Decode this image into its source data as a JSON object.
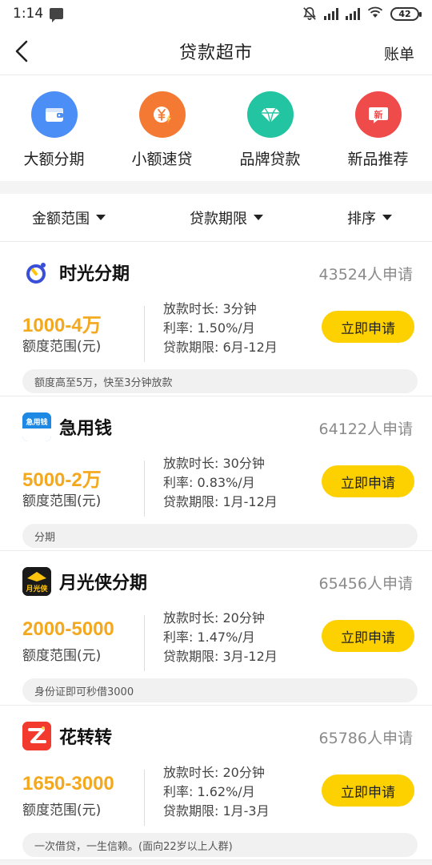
{
  "status_bar": {
    "time": "1:14",
    "battery": "42"
  },
  "nav": {
    "title": "贷款超市",
    "right_label": "账单"
  },
  "categories": [
    {
      "label": "大额分期",
      "icon": "wallet-icon",
      "color": "#4b8ef5"
    },
    {
      "label": "小额速贷",
      "icon": "yen-lightning-icon",
      "color": "#f47a34"
    },
    {
      "label": "品牌贷款",
      "icon": "diamond-icon",
      "color": "#22c4a1"
    },
    {
      "label": "新品推荐",
      "icon": "new-badge-icon",
      "color": "#f04b4b",
      "badge_text": "新"
    }
  ],
  "filters": [
    {
      "label": "金额范围"
    },
    {
      "label": "贷款期限"
    },
    {
      "label": "排序"
    }
  ],
  "common": {
    "amount_label": "额度范围(元)",
    "apply_label": "立即申请"
  },
  "products": [
    {
      "name": "时光分期",
      "count": "43524人申请",
      "amount": "1000-4万",
      "duration": "放款时长: 3分钟",
      "rate": "利率: 1.50%/月",
      "term": "贷款期限: 6月-12月",
      "tag": "额度高至5万，快至3分钟放款",
      "logo": "time-installment-logo"
    },
    {
      "name": "急用钱",
      "count": "64122人申请",
      "amount": "5000-2万",
      "duration": "放款时长: 30分钟",
      "rate": "利率: 0.83%/月",
      "term": "贷款期限: 1月-12月",
      "tag": "分期",
      "logo": "urgent-money-logo",
      "logo_text": "急用钱"
    },
    {
      "name": "月光侠分期",
      "count": "65456人申请",
      "amount": "2000-5000",
      "duration": "放款时长: 20分钟",
      "rate": "利率: 1.47%/月",
      "term": "贷款期限: 3月-12月",
      "tag": "身份证即可秒借3000",
      "logo": "moonlight-hero-logo",
      "logo_text": "月光侠"
    },
    {
      "name": "花转转",
      "count": "65786人申请",
      "amount": "1650-3000",
      "duration": "放款时长: 20分钟",
      "rate": "利率: 1.62%/月",
      "term": "贷款期限: 1月-3月",
      "tag": "一次借贷，一生信赖。(面向22岁以上人群)",
      "logo": "hua-zhuanzhuan-logo"
    }
  ]
}
